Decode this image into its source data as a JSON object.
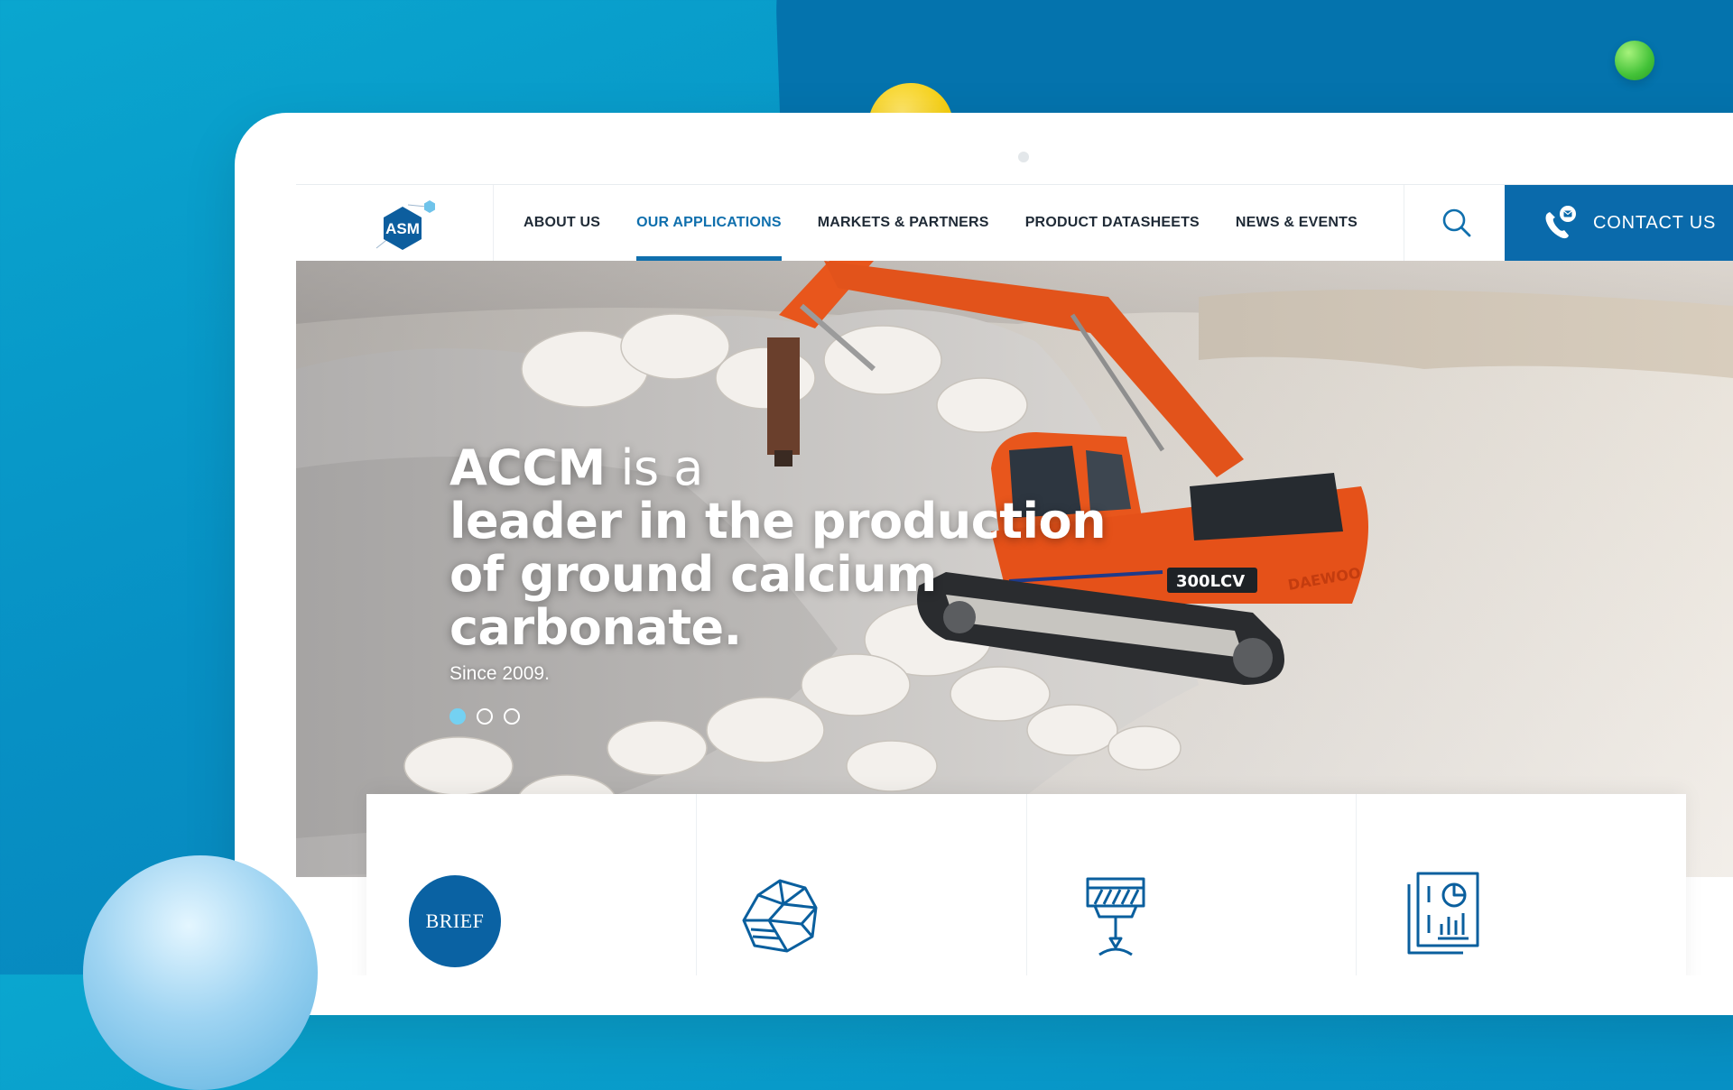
{
  "logo": {
    "text": "ASM"
  },
  "nav": {
    "items": [
      {
        "label": "ABOUT US",
        "active": false
      },
      {
        "label": "OUR APPLICATIONS",
        "active": true
      },
      {
        "label": "MARKETS & PARTNERS",
        "active": false
      },
      {
        "label": "PRODUCT DATASHEETS",
        "active": false
      },
      {
        "label": "NEWS & EVENTS",
        "active": false
      }
    ],
    "search_icon": "search-icon",
    "contact_label": "CONTACT US",
    "contact_icon": "phone-mail-icon"
  },
  "hero": {
    "title_bold_1": "ACCM",
    "title_light_1": " is a",
    "title_line_2": "leader in the production",
    "title_line_3": "of ground calcium",
    "title_line_4": "carbonate.",
    "subtitle": "Since 2009.",
    "slides_total": 3,
    "slide_active": 1,
    "excavator_model": "300LCV",
    "excavator_brand": "DAEWOO"
  },
  "cards": [
    {
      "icon": "brief-badge-icon",
      "badge": "BRIEF"
    },
    {
      "icon": "mineral-rock-icon"
    },
    {
      "icon": "grinder-drill-icon"
    },
    {
      "icon": "report-chart-icon"
    }
  ],
  "colors": {
    "brand_blue": "#0a6aab",
    "active_nav": "#0f6fad",
    "dot_active": "#74d1f2",
    "excavator_orange": "#e8561c",
    "background": "#0aa6cf"
  }
}
